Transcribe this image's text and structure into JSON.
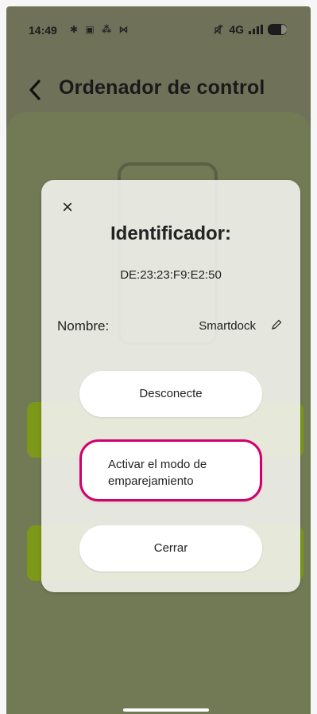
{
  "status_bar": {
    "time": "14:49",
    "left_icons": "✱ ▣ ⁂ ⋈",
    "network": "4G",
    "signal_icon": "signal-icon",
    "battery_icon": "battery-icon"
  },
  "header": {
    "title": "Ordenador de control",
    "back_icon": "chevron-left-icon"
  },
  "modal": {
    "close_symbol": "×",
    "title": "Identificador:",
    "identifier": "DE:23:23:F9:E2:50",
    "name_label": "Nombre:",
    "name_value": "Smartdock",
    "edit_icon": "pencil-icon",
    "disconnect_label": "Desconecte",
    "pair_label_line1": "Activar el modo de",
    "pair_label_line2": "emparejamiento",
    "close_label": "Cerrar"
  },
  "colors": {
    "overlay": "#6f7159",
    "card_bg": "#727a55",
    "accent_green": "#7e9a13",
    "highlight": "#d1006e",
    "button_bg": "#ffffff"
  }
}
